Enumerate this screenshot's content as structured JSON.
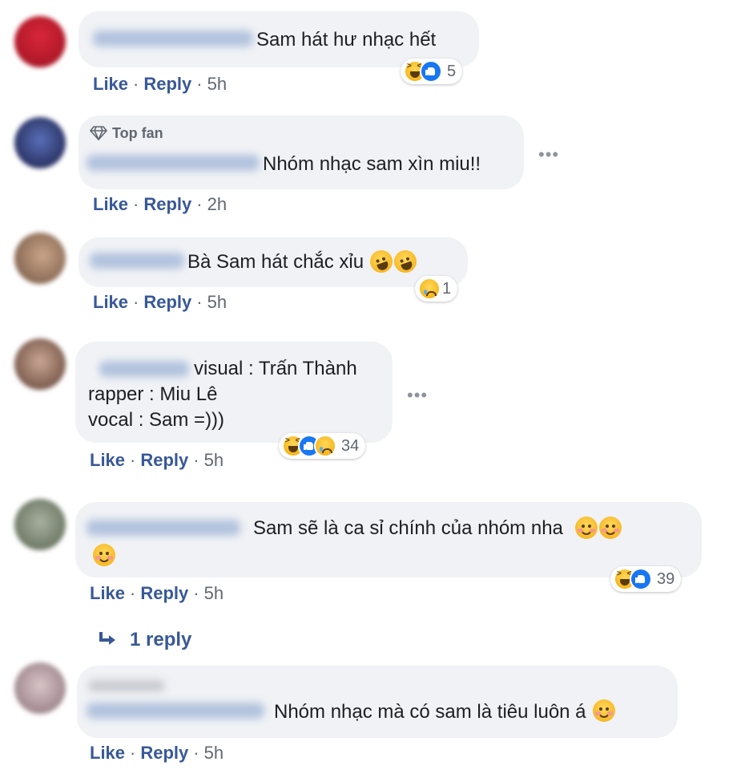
{
  "labels": {
    "like": "Like",
    "reply": "Reply",
    "dot": "·",
    "more": "•••"
  },
  "colors": {
    "bubble": "#f0f2f5",
    "link": "#385898",
    "meta": "#606770",
    "like_blue": "#1877f2",
    "haha_yellow": "#f7b928"
  },
  "comments": [
    {
      "text": "Sam hát hư nhạc hết",
      "time": "5h",
      "reactions": [
        "haha-icon",
        "like-icon"
      ],
      "reaction_count": "5"
    },
    {
      "badge": "Top fan",
      "badge_icon": "diamond-icon",
      "text": "Nhóm nhạc sam xìn miu!!",
      "time": "2h"
    },
    {
      "text": "Bà Sam hát chắc xỉu",
      "inline_emoji": [
        "rolling-laughing-emoji",
        "rolling-laughing-emoji"
      ],
      "time": "5h",
      "reactions": [
        "sad-icon"
      ],
      "reaction_count": "1"
    },
    {
      "text": "visual : Trấn Thành\nrapper : Miu Lê\nvocal : Sam =)))",
      "time": "5h",
      "reactions": [
        "haha-icon",
        "like-icon",
        "sad-icon"
      ],
      "reaction_count": "34"
    },
    {
      "text": "Sam sẽ là ca sỉ chính của nhóm nha",
      "inline_emoji": [
        "smiling-blush-emoji",
        "smiling-blush-emoji",
        "smiling-blush-emoji"
      ],
      "time": "5h",
      "reactions": [
        "haha-icon",
        "like-icon"
      ],
      "reaction_count": "39",
      "replies_label": "1 reply"
    },
    {
      "text": "Nhóm nhạc mà có sam là tiêu luôn á",
      "inline_emoji": [
        "smiling-blush-emoji"
      ],
      "time": "5h"
    }
  ]
}
